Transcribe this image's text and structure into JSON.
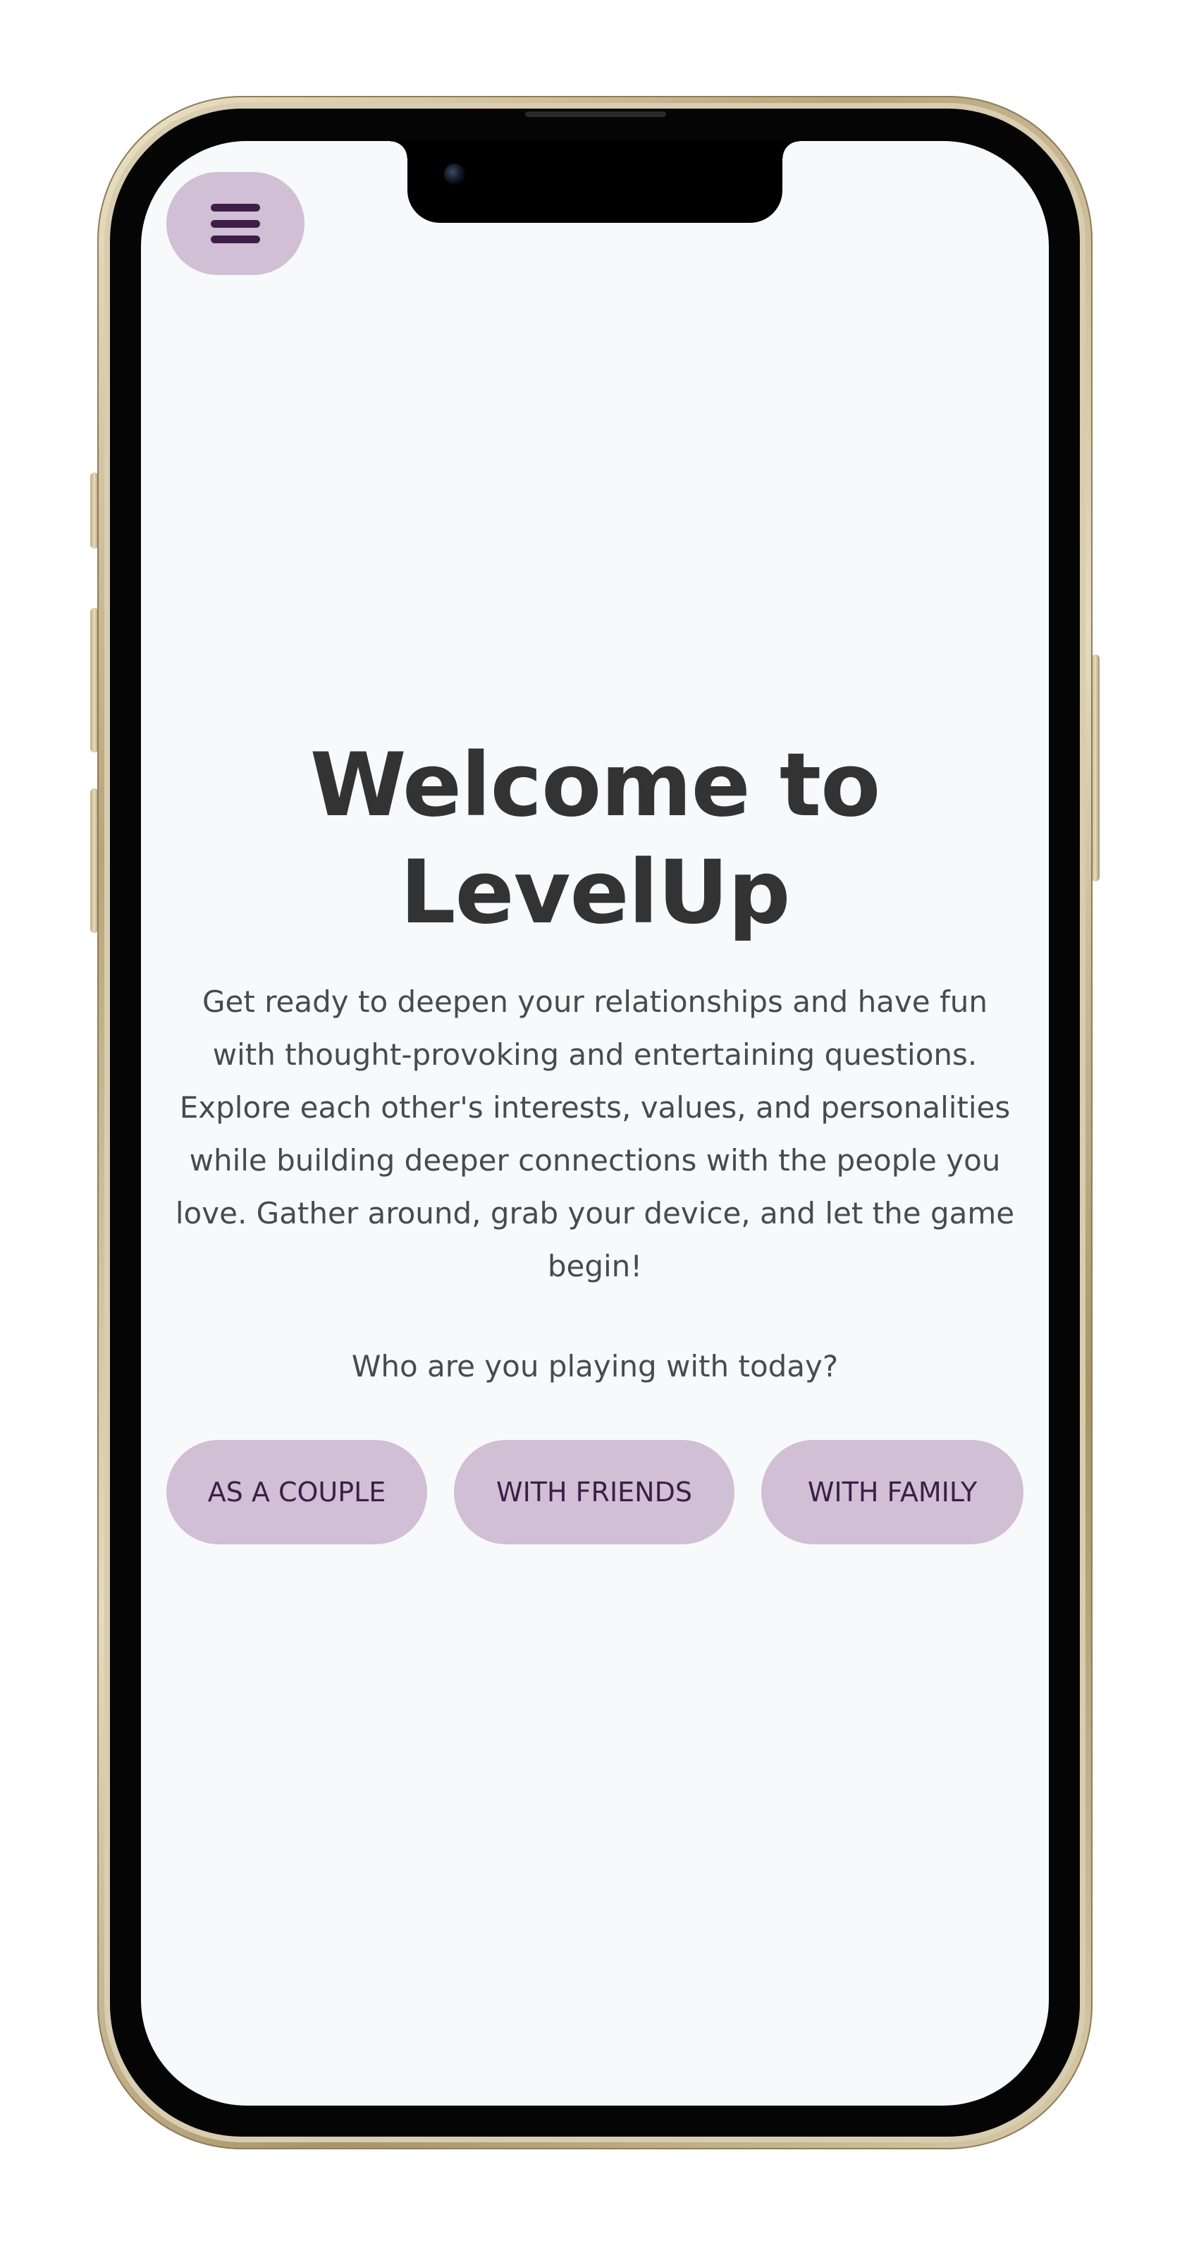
{
  "header": {
    "menu_icon": "hamburger-menu-icon"
  },
  "welcome": {
    "title_line1": "Welcome to",
    "title_line2": "LevelUp",
    "intro": "Get ready to deepen your relationships and have fun with thought-provoking and entertaining questions. Explore each other's interests, values, and personalities while building deeper connections with the people you love. Gather around, grab your device, and let the game begin!",
    "prompt": "Who are you playing with today?"
  },
  "choices": [
    {
      "label": "AS A COUPLE"
    },
    {
      "label": "WITH FRIENDS"
    },
    {
      "label": "WITH FAMILY"
    }
  ],
  "colors": {
    "accent": "#d1bfd5",
    "accent_text": "#3d1e48",
    "background": "#f8f9fb",
    "heading": "#333333",
    "body_text": "#4a4a4a"
  }
}
